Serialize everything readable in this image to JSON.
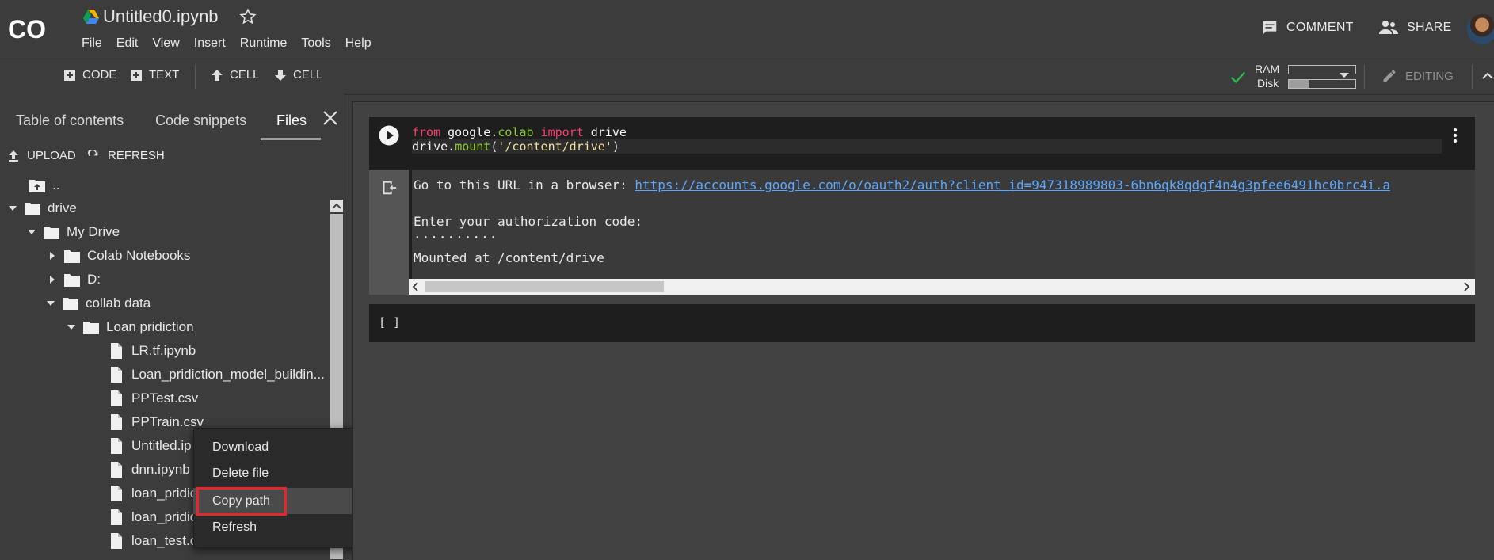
{
  "header": {
    "logo_text": "CO",
    "notebook_title": "Untitled0.ipynb",
    "menu": [
      "File",
      "Edit",
      "View",
      "Insert",
      "Runtime",
      "Tools",
      "Help"
    ],
    "comment_label": "COMMENT",
    "share_label": "SHARE"
  },
  "toolbar": {
    "code_label": "CODE",
    "text_label": "TEXT",
    "cell_up_label": "CELL",
    "cell_down_label": "CELL",
    "ram_label": "RAM",
    "disk_label": "Disk",
    "ram_usage_fraction": 0.0,
    "disk_usage_fraction": 0.3,
    "editing_label": "EDITING"
  },
  "sidebar": {
    "tabs": [
      "Table of contents",
      "Code snippets",
      "Files"
    ],
    "active_tab": "Files",
    "upload_label": "UPLOAD",
    "refresh_label": "REFRESH",
    "tree": [
      {
        "label": "..",
        "type": "up",
        "depth": 1
      },
      {
        "label": "drive",
        "type": "folder",
        "depth": 0,
        "open": true
      },
      {
        "label": "My Drive",
        "type": "folder",
        "depth": 1,
        "open": true
      },
      {
        "label": "Colab Notebooks",
        "type": "folder",
        "depth": 2,
        "open": false
      },
      {
        "label": "D:",
        "type": "folder",
        "depth": 2,
        "open": false
      },
      {
        "label": "collab data",
        "type": "folder",
        "depth": 2,
        "open": true
      },
      {
        "label": "Loan pridiction",
        "type": "folder",
        "depth": 3,
        "open": true
      },
      {
        "label": "LR.tf.ipynb",
        "type": "file",
        "depth": 5
      },
      {
        "label": "Loan_pridiction_model_buildin...",
        "type": "file",
        "depth": 5
      },
      {
        "label": "PPTest.csv",
        "type": "file",
        "depth": 5
      },
      {
        "label": "PPTrain.csv",
        "type": "file",
        "depth": 5
      },
      {
        "label": "Untitled.ip",
        "type": "file",
        "depth": 5
      },
      {
        "label": "dnn.ipynb",
        "type": "file",
        "depth": 5
      },
      {
        "label": "loan_pridic",
        "type": "file",
        "depth": 5
      },
      {
        "label": "loan_pridic",
        "type": "file",
        "depth": 5
      },
      {
        "label": "loan_test.c",
        "type": "file",
        "depth": 5
      }
    ]
  },
  "context_menu": {
    "items": [
      "Download",
      "Delete file",
      "Copy path",
      "Refresh"
    ],
    "highlighted": "Copy path"
  },
  "cells": {
    "cell1": {
      "code_line1": {
        "kw1": "from",
        "mod": " google",
        "dot": ".",
        "sub": "colab",
        "kw2": " import",
        "name": " drive"
      },
      "code_line2": {
        "obj": "drive",
        "dot": ".",
        "fn": "mount",
        "open": "(",
        "str": "'/content/drive'",
        "close": ")"
      },
      "output": {
        "prompt_text": "Go to this URL in a browser: ",
        "url": "https://accounts.google.com/o/oauth2/auth?client_id=947318989803-6bn6qk8qdgf4n4g3pfee6491hc0brc4i.a",
        "auth_prompt": "Enter your authorization code:",
        "masked_code": "··········",
        "mounted": "Mounted at /content/drive"
      }
    },
    "cell2": {
      "prompt": "[ ]"
    }
  },
  "colors": {
    "background": "#3c3c3c",
    "keyword": "#ff3b6b",
    "function": "#8ccc2e",
    "link": "#5aa7ff",
    "highlight_box": "#e5262b",
    "status_ok": "#2eb84a"
  }
}
